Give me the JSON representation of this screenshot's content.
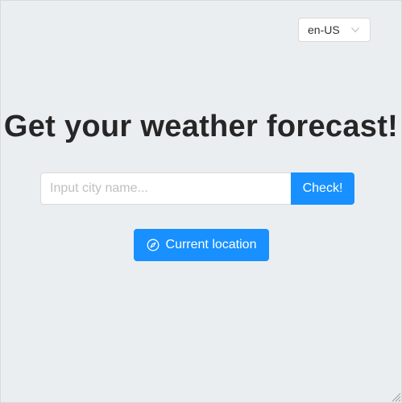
{
  "language_select": {
    "value": "en-US",
    "icon": "chevron-down-icon"
  },
  "header": {
    "title": "Get your weather forecast!"
  },
  "search": {
    "placeholder": "Input city name...",
    "value": "",
    "button_label": "Check!"
  },
  "location": {
    "button_label": "Current location",
    "icon": "compass-icon"
  },
  "colors": {
    "background": "#ebeef1",
    "accent": "#1890ff",
    "title": "#262626"
  }
}
